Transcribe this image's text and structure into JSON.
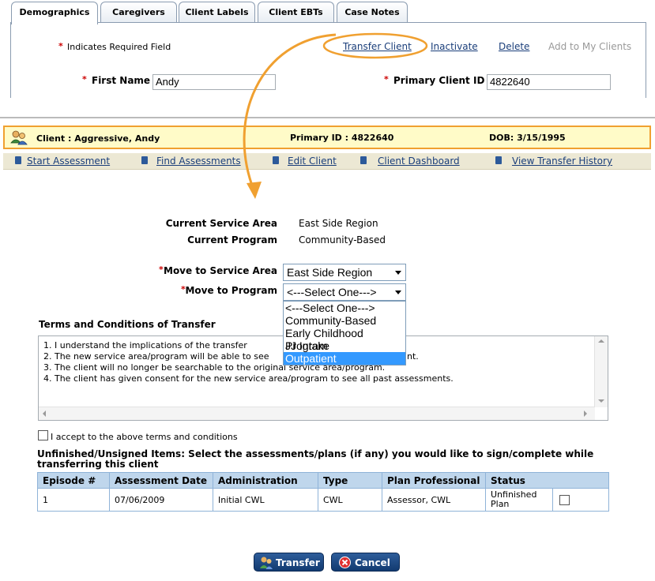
{
  "tabs": [
    "Demographics",
    "Caregivers",
    "Client Labels",
    "Client EBTs",
    "Case Notes"
  ],
  "top": {
    "required_note": "Indicates Required Field",
    "required_mark": "*",
    "links": {
      "transfer": "Transfer Client",
      "inactivate": "Inactivate",
      "delete": "Delete",
      "add": "Add to My Clients"
    },
    "first_name_label": "First Name",
    "first_name_value": "Andy",
    "primary_id_label": "Primary Client ID",
    "primary_id_value": "4822640"
  },
  "client_header": {
    "client": "Client : Aggressive, Andy",
    "primary_id": "Primary ID : 4822640",
    "dob": "DOB: 3/15/1995"
  },
  "actions": [
    "Start Assessment",
    "Find Assessments",
    "Edit Client",
    "Client Dashboard",
    "View Transfer History"
  ],
  "form": {
    "current_area_label": "Current Service Area",
    "current_area_value": "East Side Region",
    "current_program_label": "Current Program",
    "current_program_value": "Community-Based",
    "move_area_label": "Move to Service Area",
    "move_area_value": "East Side Region",
    "move_program_label": "Move to Program",
    "move_program_value": "<---Select One--->",
    "program_options": [
      "<---Select One--->",
      "Community-Based",
      "Early Childhood Program",
      "JJ Intake",
      "Outpatient"
    ],
    "highlighted_option": "Outpatient"
  },
  "terms": {
    "title": "Terms and Conditions of Transfer",
    "lines": [
      "1. I understand the implications of the transfer",
      "2. The new service area/program will be able to see",
      "3. The client will no longer be searchable to the original service area/program.",
      "4. The client has given consent for the new service area/program to see all past assessments."
    ],
    "line2_tail": "nt.",
    "accept_label": "I accept to the above terms and conditions"
  },
  "unfinished": {
    "title": "Unfinished/Unsigned Items: Select the assessments/plans (if any) you would like to sign/complete while transferring this client",
    "headers": [
      "Episode #",
      "Assessment Date",
      "Administration",
      "Type",
      "Plan Professional",
      "Status"
    ],
    "rows": [
      {
        "episode": "1",
        "date": "07/06/2009",
        "admin": "Initial CWL",
        "type": "CWL",
        "professional": "Assessor, CWL",
        "status": "Unfinished Plan"
      }
    ]
  },
  "buttons": {
    "transfer": "Transfer",
    "cancel": "Cancel"
  },
  "colors": {
    "accent_orange": "#f0a030",
    "link_blue": "#1a3e7a",
    "highlight": "#3399ff"
  }
}
